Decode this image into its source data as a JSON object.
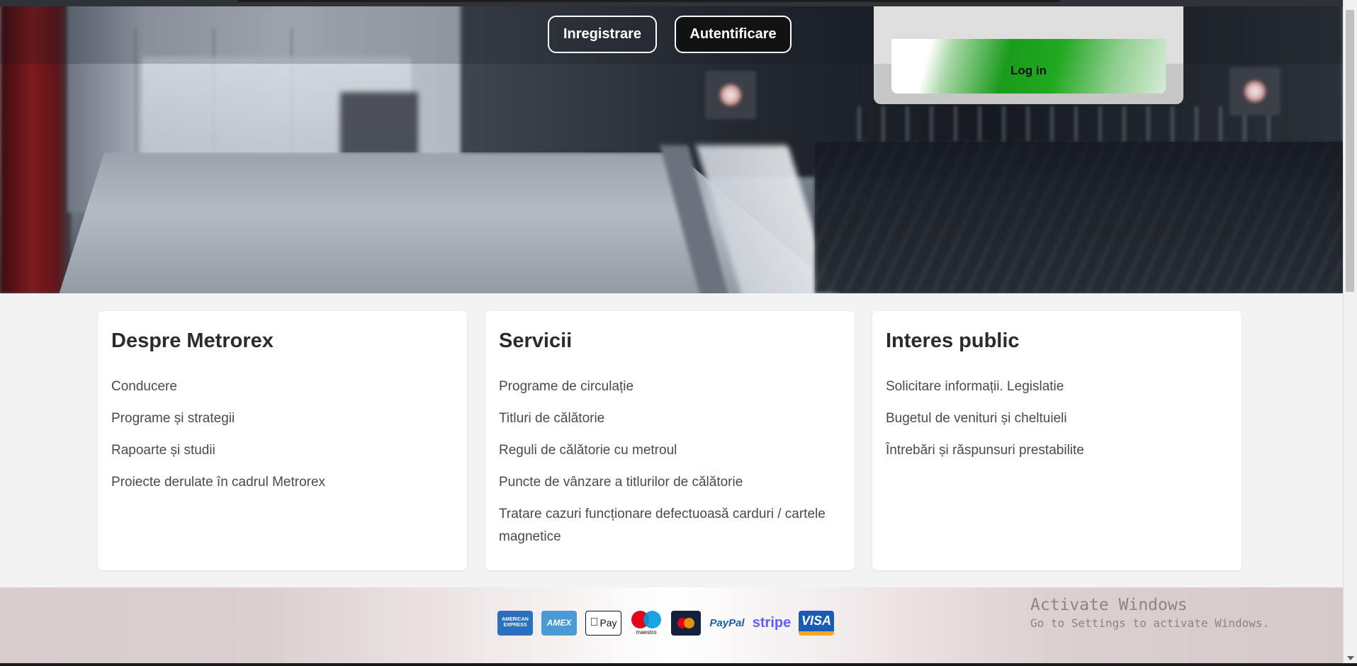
{
  "nav": {
    "register_label": "Inregistrare",
    "login_label": "Autentificare"
  },
  "login_card": {
    "login_button_label": "Log in",
    "button_color": "#1a9c1a"
  },
  "footer": {
    "columns": [
      {
        "title": "Despre Metrorex",
        "links": [
          "Conducere",
          "Programe și strategii",
          "Rapoarte și studii",
          "Proiecte derulate în cadrul Metrorex"
        ]
      },
      {
        "title": "Servicii",
        "links": [
          "Programe de circulație",
          "Titluri de călătorie",
          "Reguli de călătorie cu metroul",
          "Puncte de vânzare a titlurilor de călătorie",
          "Tratare cazuri funcționare defectuoasă carduri / cartele magnetice"
        ]
      },
      {
        "title": "Interes public",
        "links": [
          "Solicitare informații. Legislatie",
          "Bugetul de venituri și cheltuieli",
          "Întrebări și răspunsuri prestabilite"
        ]
      }
    ]
  },
  "payments": {
    "icons": [
      "american-express-icon",
      "amex-icon",
      "apple-pay-icon",
      "maestro-icon",
      "mastercard-icon",
      "paypal-icon",
      "stripe-icon",
      "visa-icon"
    ],
    "amex_text": "AMERICAN EXPRESS",
    "amex2_text": "AMEX",
    "apple_text": "Pay",
    "maestro_text": "maestro",
    "paypal_text": "PayPal",
    "stripe_text": "stripe",
    "visa_text": "VISA"
  },
  "watermark": {
    "line1": "Activate Windows",
    "line2": "Go to Settings to activate Windows."
  }
}
